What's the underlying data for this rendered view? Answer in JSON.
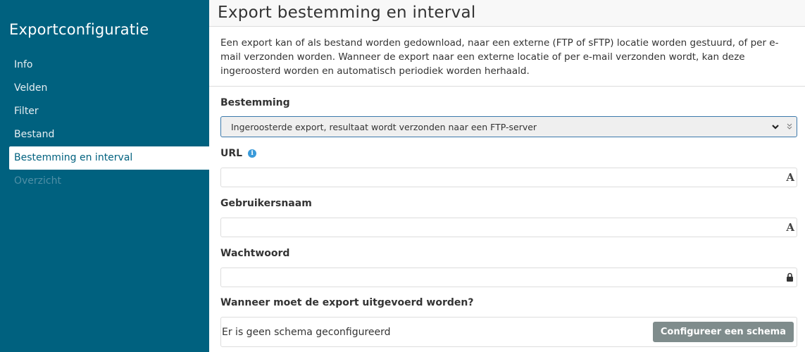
{
  "sidebar": {
    "title": "Exportconfiguratie",
    "items": [
      {
        "label": "Info",
        "state": "normal"
      },
      {
        "label": "Velden",
        "state": "normal"
      },
      {
        "label": "Filter",
        "state": "normal"
      },
      {
        "label": "Bestand",
        "state": "normal"
      },
      {
        "label": "Bestemming en interval",
        "state": "active"
      },
      {
        "label": "Overzicht",
        "state": "disabled"
      }
    ]
  },
  "page": {
    "title": "Export bestemming en interval",
    "intro": "Een export kan of als bestand worden gedownload, naar een externe (FTP of sFTP) locatie worden gestuurd, of per e-mail verzonden worden. Wanneer de export naar een externe locatie of per e-mail verzonden wordt, kan deze ingeroosterd worden en automatisch periodiek worden herhaald."
  },
  "form": {
    "destination": {
      "label": "Bestemming",
      "selected": "Ingeroosterde export, resultaat wordt verzonden naar een FTP-server",
      "icons": [
        "chevron-down-icon",
        "double-chevron-icon"
      ]
    },
    "url": {
      "label": "URL",
      "value": "",
      "icon": "text-icon",
      "info_icon": "info-icon",
      "info_glyph": "i"
    },
    "username": {
      "label": "Gebruikersnaam",
      "value": "",
      "icon": "text-icon",
      "icon_glyph": "A"
    },
    "password": {
      "label": "Wachtwoord",
      "value": "",
      "icon": "lock-icon"
    },
    "schedule": {
      "label": "Wanneer moet de export uitgevoerd worden?",
      "status": "Er is geen schema geconfigureerd",
      "button_label": "Configureer een schema"
    }
  },
  "colors": {
    "sidebar_bg": "#00617f",
    "button_bg": "#7f8c8c",
    "select_border": "#3c79ab",
    "info_icon": "#3a9ad9"
  }
}
